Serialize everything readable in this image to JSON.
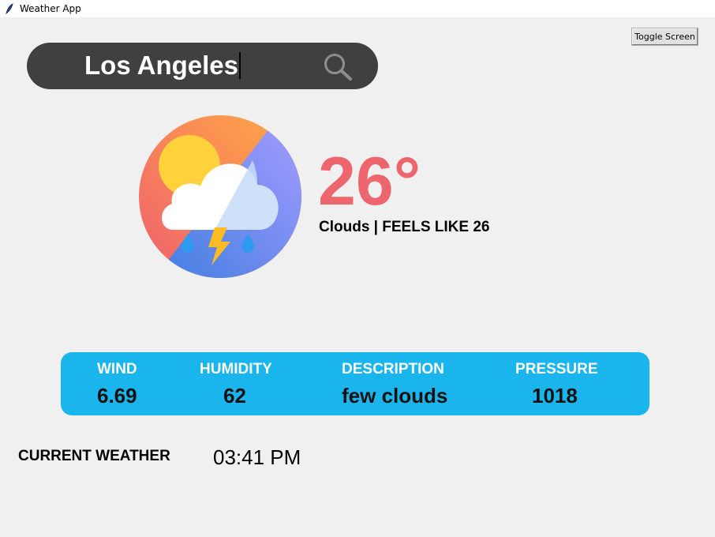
{
  "window": {
    "title": "Weather App"
  },
  "toolbar": {
    "toggle_label": "Toggle Screen"
  },
  "search": {
    "value": "Los Angeles"
  },
  "current": {
    "temperature": "26°",
    "summary": "Clouds | FEELS LIKE 26"
  },
  "details": {
    "wind": {
      "label": "WIND",
      "value": "6.69"
    },
    "humidity": {
      "label": "HUMIDITY",
      "value": "62"
    },
    "description": {
      "label": "DESCRIPTION",
      "value": "few clouds"
    },
    "pressure": {
      "label": "PRESSURE",
      "value": "1018"
    }
  },
  "footer": {
    "label": "CURRENT WEATHER",
    "time": "03:41 PM"
  },
  "colors": {
    "background": "#f0f0f0",
    "search_bar": "#404040",
    "temperature": "#ee666d",
    "info_panel": "#1ab5ec"
  },
  "icons": {
    "app": "feather-icon",
    "search": "search-icon",
    "weather": "sun-cloud-thunder-icon"
  }
}
